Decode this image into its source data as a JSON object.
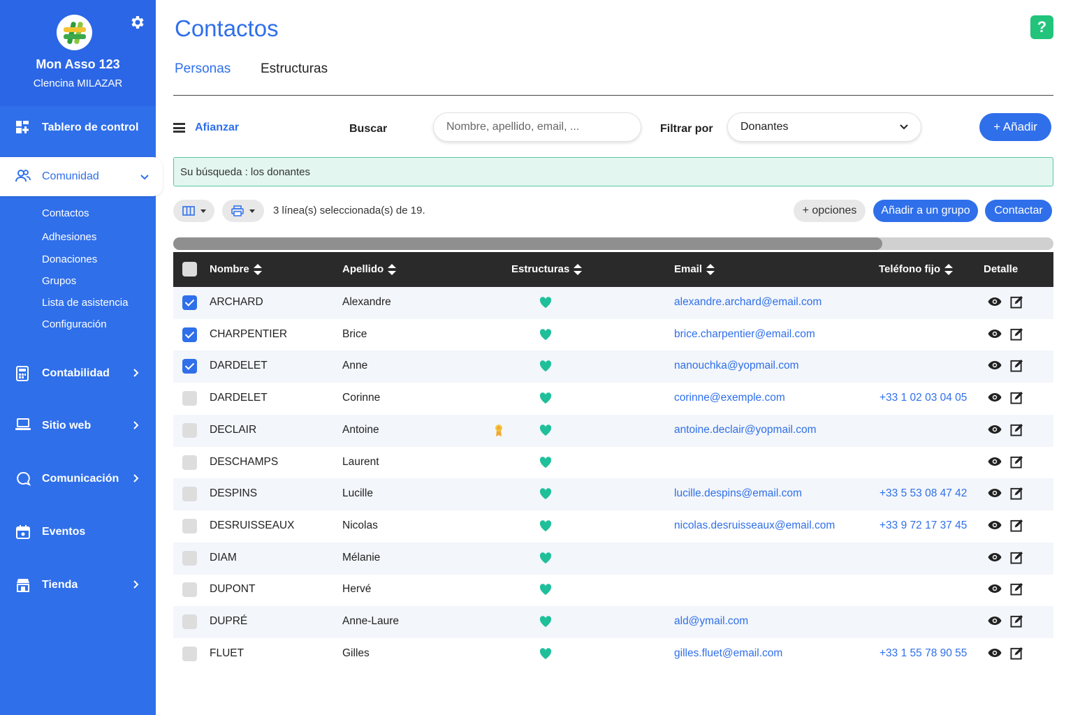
{
  "sidebar": {
    "org_name": "Mon Asso 123",
    "user_name": "Clencina MILAZAR",
    "items": [
      {
        "label": "Tablero de control",
        "icon": "dashboard-icon"
      },
      {
        "label": "Comunidad",
        "icon": "users-icon",
        "active": true
      },
      {
        "label": "Contabilidad",
        "icon": "calculator-icon"
      },
      {
        "label": "Sitio web",
        "icon": "laptop-icon"
      },
      {
        "label": "Comunicación",
        "icon": "chat-icon"
      },
      {
        "label": "Eventos",
        "icon": "calendar-icon"
      },
      {
        "label": "Tienda",
        "icon": "shop-icon"
      }
    ],
    "subitems": [
      "Contactos",
      "Adhesiones",
      "Donaciones",
      "Grupos",
      "Lista de asistencia",
      "Configuración"
    ]
  },
  "header": {
    "title": "Contactos",
    "help": "?",
    "tabs": [
      "Personas",
      "Estructuras"
    ]
  },
  "toolbar": {
    "refine": "Afianzar",
    "search_label": "Buscar",
    "search_placeholder": "Nombre, apellido, email, ...",
    "filter_label": "Filtrar por",
    "filter_value": "Donantes",
    "add_label": "+ Añadir"
  },
  "notice": "Su búsqueda : los donantes",
  "selection": {
    "count_text": "3 línea(s) seleccionada(s) de 19.",
    "options_label": "+ opciones",
    "add_group_label": "Añadir a un grupo",
    "contact_label": "Contactar"
  },
  "table": {
    "headers": [
      "Nombre",
      "Apellido",
      "Estructuras",
      "Email",
      "Teléfono fijo",
      "Detalle"
    ],
    "rows": [
      {
        "nombre": "ARCHARD",
        "apellido": "Alexandre",
        "email": "alexandre.archard@email.com",
        "telefono": "",
        "checked": true
      },
      {
        "nombre": "CHARPENTIER",
        "apellido": "Brice",
        "email": "brice.charpentier@email.com",
        "telefono": "",
        "checked": true
      },
      {
        "nombre": "DARDELET",
        "apellido": "Anne",
        "email": "nanouchka@yopmail.com",
        "telefono": "",
        "checked": true
      },
      {
        "nombre": "DARDELET",
        "apellido": "Corinne",
        "email": "corinne@exemple.com",
        "telefono": "+33 1 02 03 04 05",
        "checked": false
      },
      {
        "nombre": "DECLAIR",
        "apellido": "Antoine",
        "email": "antoine.declair@yopmail.com",
        "telefono": "",
        "checked": false,
        "medal": true
      },
      {
        "nombre": "DESCHAMPS",
        "apellido": "Laurent",
        "email": "",
        "telefono": "",
        "checked": false
      },
      {
        "nombre": "DESPINS",
        "apellido": "Lucille",
        "email": "lucille.despins@email.com",
        "telefono": "+33 5 53 08 47 42",
        "checked": false
      },
      {
        "nombre": "DESRUISSEAUX",
        "apellido": "Nicolas",
        "email": "nicolas.desruisseaux@email.com",
        "telefono": "+33 9 72 17 37 45",
        "checked": false
      },
      {
        "nombre": "DIAM",
        "apellido": "Mélanie",
        "email": "",
        "telefono": "",
        "checked": false
      },
      {
        "nombre": "DUPONT",
        "apellido": "Hervé",
        "email": "",
        "telefono": "",
        "checked": false
      },
      {
        "nombre": "DUPRÉ",
        "apellido": "Anne-Laure",
        "email": "ald@ymail.com",
        "telefono": "",
        "checked": false
      },
      {
        "nombre": "FLUET",
        "apellido": "Gilles",
        "email": "gilles.fluet@email.com",
        "telefono": "+33 1 55 78 90 55",
        "checked": false
      }
    ]
  },
  "colors": {
    "primary": "#2f6fea",
    "sidebar": "#2f6fea",
    "heart": "#1fbf9a",
    "help": "#22c37b",
    "header_dark": "#2a2a2a"
  }
}
